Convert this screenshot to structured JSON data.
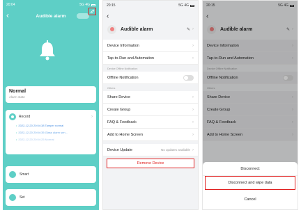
{
  "colors": {
    "accent": "#5ecfc6",
    "highlight": "#e02020",
    "link": "#4a90e2"
  },
  "status": {
    "time1": "20:04",
    "time2": "20:15",
    "time3": "20:15",
    "right": "5G 4G"
  },
  "panel1": {
    "title": "Audible alarm",
    "state_title": "Normal",
    "state_sub": "Alarm state",
    "record_label": "Record",
    "record_lines": [
      "2022-12-20 20:04:38 Tamper normal",
      "2022-12-20 20:04:35 Glass alarm sen...",
      "2022-12-20 20:04:25 Normal"
    ],
    "smart_label": "Smart",
    "set_label": "Set"
  },
  "panel2": {
    "device_name": "Audible alarm",
    "rows_top": [
      "Device Information",
      "Tap-to-Run and Automation"
    ],
    "sec_offline": "Device Offline Notification",
    "offline_row": "Offline Notification",
    "sec_others": "Others",
    "rows_others": [
      "Share Device",
      "Create Group",
      "FAQ & Feedback",
      "Add to Home Screen"
    ],
    "update_row": "Device Update",
    "update_value": "No updates available",
    "remove_label": "Remove Device"
  },
  "panel3": {
    "device_name": "Audible alarm",
    "rows_top": [
      "Device Information",
      "Tap-to-Run and Automation"
    ],
    "sec_offline": "Device Offline Notification",
    "offline_row": "Offline Notification",
    "sec_others": "Others",
    "rows_others": [
      "Share Device",
      "Create Group",
      "FAQ & Feedback",
      "Add to Home Screen"
    ],
    "sheet_disconnect": "Disconnect",
    "sheet_wipe": "Disconnect and wipe data",
    "sheet_cancel": "Cancel"
  }
}
